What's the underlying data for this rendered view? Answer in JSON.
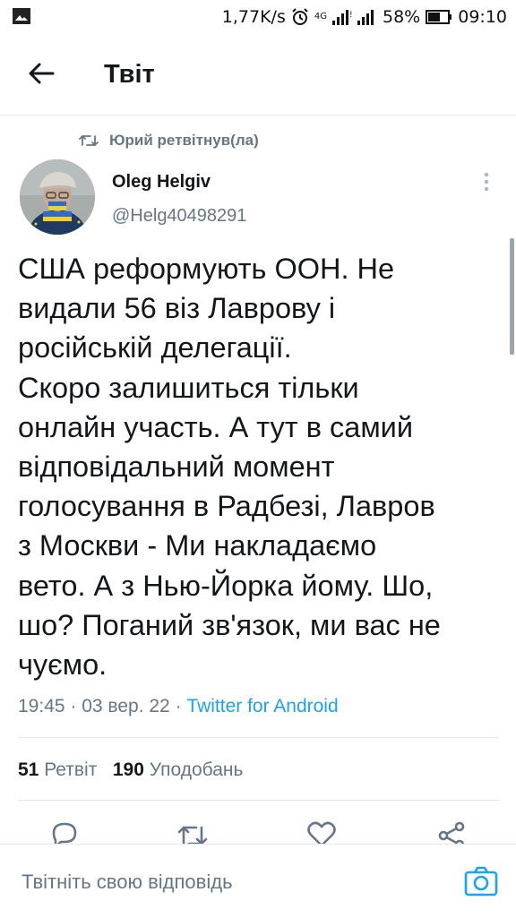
{
  "status_bar": {
    "speed": "1,77K/s",
    "network": "4G",
    "battery": "58%",
    "time": "09:10"
  },
  "header": {
    "title": "Твіт"
  },
  "retweet": {
    "label": "Юрий ретвітнув(ла)"
  },
  "tweet": {
    "author_name": "Oleg Helgiv",
    "author_handle": "@Helg40498291",
    "text": "США реформують ООН. Не\nвидали 56 віз Лаврову і\nросійській делегації.\nСкоро залишиться тільки\nонлайн участь. А тут в самий\nвідповідальний момент\nголосування в Радбезі, Лавров\nз Москви - Ми накладаємо\nвето. А з Нью-Йорка йому. Шо,\nшо? Поганий зв'язок, ми вас не\nчуємо.",
    "time": "19:45",
    "date": "03 вер. 22",
    "source": "Twitter for Android",
    "separator": " · "
  },
  "stats": {
    "retweets_count": "51",
    "retweets_label": "Ретвіт",
    "likes_count": "190",
    "likes_label": "Уподобань"
  },
  "actions": [
    "reply-icon",
    "retweet-icon",
    "like-icon",
    "share-icon"
  ],
  "reply_bar": {
    "placeholder": "Твітніть свою відповідь"
  },
  "colors": {
    "accent": "#1da1f2",
    "secondary_text": "#657786",
    "primary_text": "#14171a",
    "divider": "#e1e8ed"
  }
}
